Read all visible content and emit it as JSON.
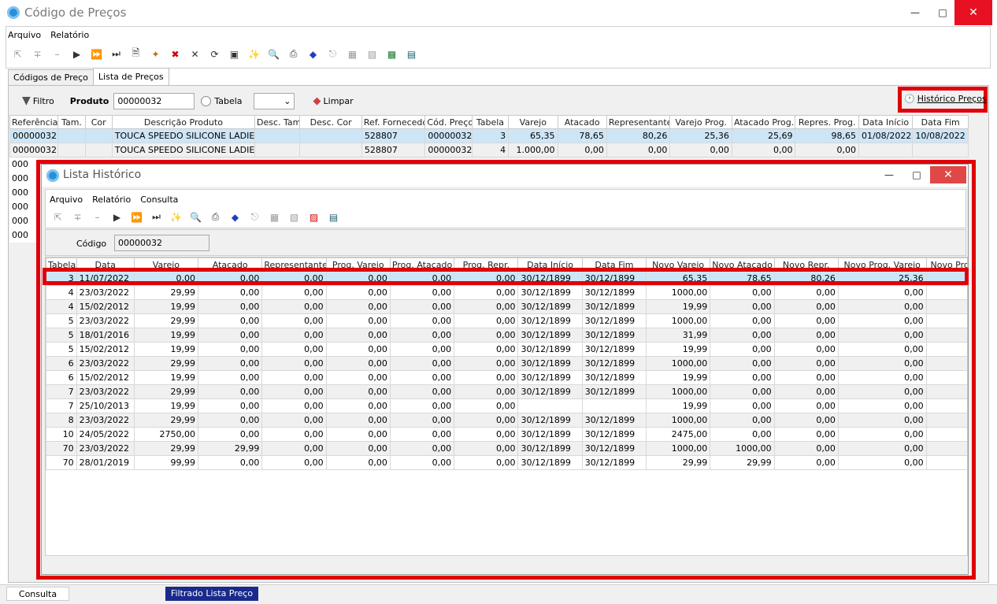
{
  "window": {
    "title": "Código de Preços"
  },
  "menu": [
    "Arquivo",
    "Relatório"
  ],
  "tabs": [
    "Códigos de Preço",
    "Lista de Preços"
  ],
  "filter": {
    "filtro_label": "Filtro",
    "produto_label": "Produto",
    "produto_value": "00000032",
    "tabela_label": "Tabela",
    "limpar_label": "Limpar",
    "historico_label": "Histórico Preços"
  },
  "main_grid": {
    "columns": [
      "Referência",
      "Tam.",
      "Cor",
      "Descrição Produto",
      "Desc. Tam.",
      "Desc. Cor",
      "Ref. Fornecedo",
      "Cód. Preço",
      "Tabela",
      "Varejo",
      "Atacado",
      "Representante",
      "Varejo Prog.",
      "Atacado Prog.",
      "Repres. Prog.",
      "Data Início",
      "Data Fim"
    ],
    "rows": [
      [
        "00000032",
        "",
        "",
        "TOUCA SPEEDO SILICONE LADIES R",
        "",
        "",
        "528807",
        "00000032",
        "3",
        "65,35",
        "78,65",
        "80,26",
        "25,36",
        "25,69",
        "98,65",
        "01/08/2022",
        "10/08/2022"
      ],
      [
        "00000032",
        "",
        "",
        "TOUCA SPEEDO SILICONE LADIES R",
        "",
        "",
        "528807",
        "00000032",
        "4",
        "1.000,00",
        "0,00",
        "0,00",
        "0,00",
        "0,00",
        "0,00",
        "",
        ""
      ]
    ],
    "hidden_refs": [
      "000",
      "000",
      "000",
      "000",
      "000",
      "000"
    ]
  },
  "sub": {
    "title": "Lista Histórico",
    "menu": [
      "Arquivo",
      "Relatório",
      "Consulta"
    ],
    "codigo_label": "Código",
    "codigo_value": "00000032",
    "columns": [
      "Tabela",
      "Data",
      "Varejo",
      "Atacado",
      "Representante",
      "Prog. Varejo",
      "Prog. Atacado",
      "Prog. Repr.",
      "Data Início",
      "Data Fim",
      "Novo Varejo",
      "Novo Atacado",
      "Novo Repr.",
      "Novo Prog. Varejo",
      "Novo Prog. A"
    ],
    "rows": [
      [
        "3",
        "11/07/2022",
        "0,00",
        "0,00",
        "0,00",
        "0,00",
        "0,00",
        "0,00",
        "30/12/1899",
        "30/12/1899",
        "65,35",
        "78,65",
        "80,26",
        "25,36",
        ""
      ],
      [
        "4",
        "23/03/2022",
        "29,99",
        "0,00",
        "0,00",
        "0,00",
        "0,00",
        "0,00",
        "30/12/1899",
        "30/12/1899",
        "1000,00",
        "0,00",
        "0,00",
        "0,00",
        ""
      ],
      [
        "4",
        "15/02/2012",
        "19,99",
        "0,00",
        "0,00",
        "0,00",
        "0,00",
        "0,00",
        "30/12/1899",
        "30/12/1899",
        "19,99",
        "0,00",
        "0,00",
        "0,00",
        ""
      ],
      [
        "5",
        "23/03/2022",
        "29,99",
        "0,00",
        "0,00",
        "0,00",
        "0,00",
        "0,00",
        "30/12/1899",
        "30/12/1899",
        "1000,00",
        "0,00",
        "0,00",
        "0,00",
        ""
      ],
      [
        "5",
        "18/01/2016",
        "19,99",
        "0,00",
        "0,00",
        "0,00",
        "0,00",
        "0,00",
        "30/12/1899",
        "30/12/1899",
        "31,99",
        "0,00",
        "0,00",
        "0,00",
        ""
      ],
      [
        "5",
        "15/02/2012",
        "19,99",
        "0,00",
        "0,00",
        "0,00",
        "0,00",
        "0,00",
        "30/12/1899",
        "30/12/1899",
        "19,99",
        "0,00",
        "0,00",
        "0,00",
        ""
      ],
      [
        "6",
        "23/03/2022",
        "29,99",
        "0,00",
        "0,00",
        "0,00",
        "0,00",
        "0,00",
        "30/12/1899",
        "30/12/1899",
        "1000,00",
        "0,00",
        "0,00",
        "0,00",
        ""
      ],
      [
        "6",
        "15/02/2012",
        "19,99",
        "0,00",
        "0,00",
        "0,00",
        "0,00",
        "0,00",
        "30/12/1899",
        "30/12/1899",
        "19,99",
        "0,00",
        "0,00",
        "0,00",
        ""
      ],
      [
        "7",
        "23/03/2022",
        "29,99",
        "0,00",
        "0,00",
        "0,00",
        "0,00",
        "0,00",
        "30/12/1899",
        "30/12/1899",
        "1000,00",
        "0,00",
        "0,00",
        "0,00",
        ""
      ],
      [
        "7",
        "25/10/2013",
        "19,99",
        "0,00",
        "0,00",
        "0,00",
        "0,00",
        "0,00",
        "",
        "",
        "19,99",
        "0,00",
        "0,00",
        "0,00",
        ""
      ],
      [
        "8",
        "23/03/2022",
        "29,99",
        "0,00",
        "0,00",
        "0,00",
        "0,00",
        "0,00",
        "30/12/1899",
        "30/12/1899",
        "1000,00",
        "0,00",
        "0,00",
        "0,00",
        ""
      ],
      [
        "10",
        "24/05/2022",
        "2750,00",
        "0,00",
        "0,00",
        "0,00",
        "0,00",
        "0,00",
        "30/12/1899",
        "30/12/1899",
        "2475,00",
        "0,00",
        "0,00",
        "0,00",
        ""
      ],
      [
        "70",
        "23/03/2022",
        "29,99",
        "29,99",
        "0,00",
        "0,00",
        "0,00",
        "0,00",
        "30/12/1899",
        "30/12/1899",
        "1000,00",
        "1000,00",
        "0,00",
        "0,00",
        ""
      ],
      [
        "70",
        "28/01/2019",
        "99,99",
        "0,00",
        "0,00",
        "0,00",
        "0,00",
        "0,00",
        "30/12/1899",
        "30/12/1899",
        "29,99",
        "29,99",
        "0,00",
        "0,00",
        ""
      ]
    ]
  },
  "status": {
    "left": "Consulta",
    "right": "Filtrado Lista Preço"
  },
  "colors": {
    "highlight": "#e0000a",
    "selection": "#cde6f7",
    "status_blue": "#1a2a8c"
  }
}
